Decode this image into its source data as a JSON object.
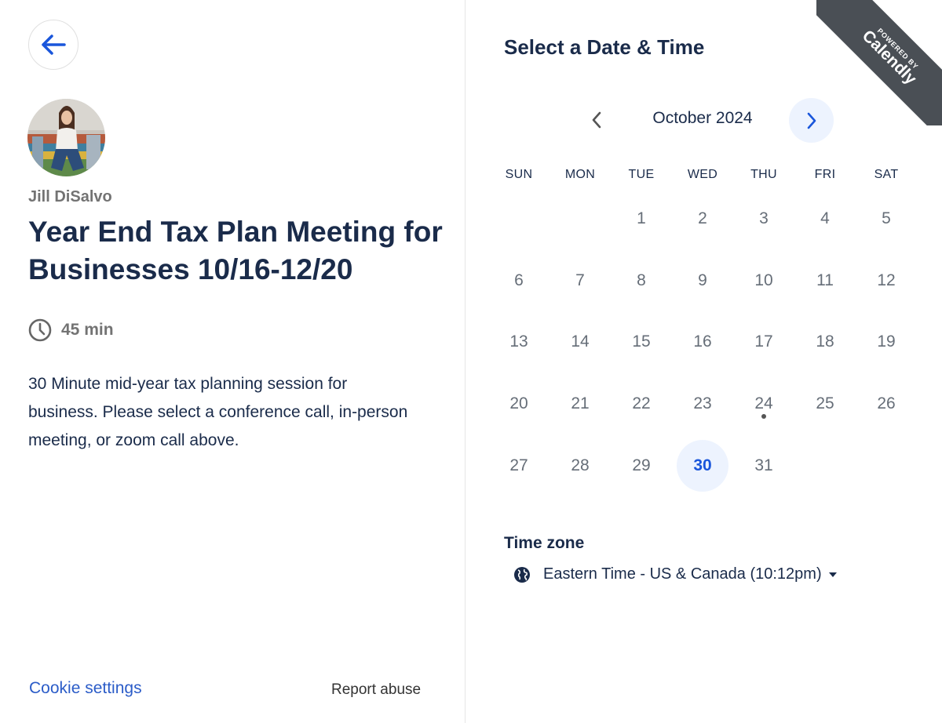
{
  "colors": {
    "primary": "#1a56db",
    "link": "#2b5cc8",
    "text_dark": "#1a2b4a",
    "text_muted": "#737373",
    "selected_bg": "#edf3fe",
    "ribbon_bg": "#4a4f55"
  },
  "left": {
    "back_icon": "arrow-left-icon",
    "host_name": "Jill DiSalvo",
    "event_title": "Year End Tax Plan Meeting for Businesses 10/16-12/20",
    "duration_icon": "clock-icon",
    "duration": "45 min",
    "description": "30 Minute mid-year tax planning session for business. Please select a conference call, in-person meeting, or zoom call above.",
    "footer": {
      "cookie_settings": "Cookie settings",
      "report_abuse": "Report abuse"
    }
  },
  "right": {
    "title": "Select a Date & Time",
    "month_label": "October 2024",
    "weekdays": [
      "SUN",
      "MON",
      "TUE",
      "WED",
      "THU",
      "FRI",
      "SAT"
    ],
    "first_weekday_index": 2,
    "days": [
      "1",
      "2",
      "3",
      "4",
      "5",
      "6",
      "7",
      "8",
      "9",
      "10",
      "11",
      "12",
      "13",
      "14",
      "15",
      "16",
      "17",
      "18",
      "19",
      "20",
      "21",
      "22",
      "23",
      "24",
      "25",
      "26",
      "27",
      "28",
      "29",
      "30",
      "31"
    ],
    "selected_day": "30",
    "today_dot_day": "24",
    "timezone_label": "Time zone",
    "timezone_icon": "globe-icon",
    "timezone_value": "Eastern Time - US & Canada (10:12pm)"
  },
  "ribbon": {
    "small": "POWERED BY",
    "big": "Calendly"
  }
}
